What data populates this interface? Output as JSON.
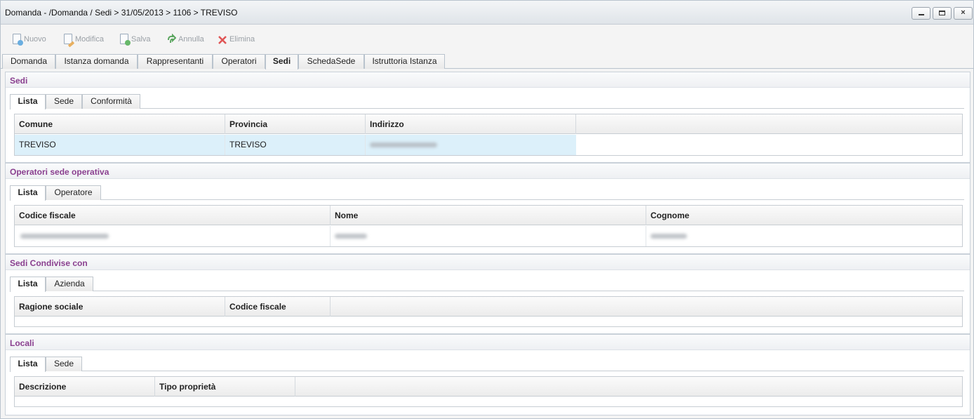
{
  "window": {
    "title": "Domanda - /Domanda / Sedi > 31/05/2013 > 1106 > TREVISO",
    "controls": {
      "minimize": "minimize",
      "maximize": "maximize",
      "close": "×"
    }
  },
  "toolbar": {
    "items": [
      {
        "label": "Nuovo",
        "icon": "new-document-icon",
        "enabled": false
      },
      {
        "label": "Modifica",
        "icon": "edit-document-icon",
        "enabled": false
      },
      {
        "label": "Salva",
        "icon": "save-icon",
        "enabled": false
      },
      {
        "label": "Annulla",
        "icon": "undo-icon",
        "enabled": false
      },
      {
        "label": "Elimina",
        "icon": "delete-icon",
        "enabled": false
      }
    ]
  },
  "main_tabs": {
    "items": [
      "Domanda",
      "Istanza domanda",
      "Rappresentanti",
      "Operatori",
      "Sedi",
      "SchedaSede",
      "Istruttoria Istanza"
    ],
    "active": "Sedi"
  },
  "sections": {
    "sedi": {
      "title": "Sedi",
      "tabs": [
        "Lista",
        "Sede",
        "Conformità"
      ],
      "active_tab": "Lista",
      "columns": [
        "Comune",
        "Provincia",
        "Indirizzo"
      ],
      "rows": [
        {
          "comune": "TREVISO",
          "provincia": "TREVISO",
          "indirizzo": "[redacted]",
          "selected": true
        }
      ]
    },
    "operatori": {
      "title": "Operatori sede operativa",
      "tabs": [
        "Lista",
        "Operatore"
      ],
      "active_tab": "Lista",
      "columns": [
        "Codice fiscale",
        "Nome",
        "Cognome"
      ],
      "rows": [
        {
          "codice_fiscale": "[redacted]",
          "nome": "[redacted]",
          "cognome": "[redacted]"
        }
      ]
    },
    "condivise": {
      "title": "Sedi Condivise con",
      "tabs": [
        "Lista",
        "Azienda"
      ],
      "active_tab": "Lista",
      "columns": [
        "Ragione sociale",
        "Codice fiscale"
      ],
      "rows": []
    },
    "locali": {
      "title": "Locali",
      "tabs": [
        "Lista",
        "Sede"
      ],
      "active_tab": "Lista",
      "columns": [
        "Descrizione",
        "Tipo proprietà"
      ],
      "rows": []
    }
  },
  "colors": {
    "section_title": "#8a3f8f",
    "selected_row": "#dcf0fa",
    "border": "#c7cdd3"
  }
}
